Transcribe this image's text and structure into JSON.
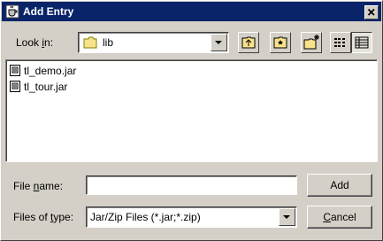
{
  "window": {
    "title": "Add Entry"
  },
  "lookin": {
    "label_pre": "Look ",
    "label_mnemonic": "i",
    "label_post": "n:",
    "value": "lib"
  },
  "toolbar": {
    "buttons": [
      "up-one-level-icon",
      "home-icon",
      "new-folder-icon",
      "list-view-icon",
      "details-view-icon"
    ]
  },
  "files": [
    {
      "name": "tl_demo.jar"
    },
    {
      "name": "tl_tour.jar"
    }
  ],
  "filename": {
    "label_pre": "File ",
    "label_mnemonic": "n",
    "label_post": "ame:",
    "value": ""
  },
  "filetype": {
    "label_pre": "Files of ",
    "label_mnemonic": "t",
    "label_post": "ype:",
    "value": "Jar/Zip Files (*.jar;*.zip)"
  },
  "buttons": {
    "add": "Add",
    "cancel_mnemonic": "C",
    "cancel_rest": "ancel"
  },
  "colors": {
    "titlebar": "#0a246a",
    "face": "#d4d0c8",
    "folder": "#f8e38a"
  }
}
